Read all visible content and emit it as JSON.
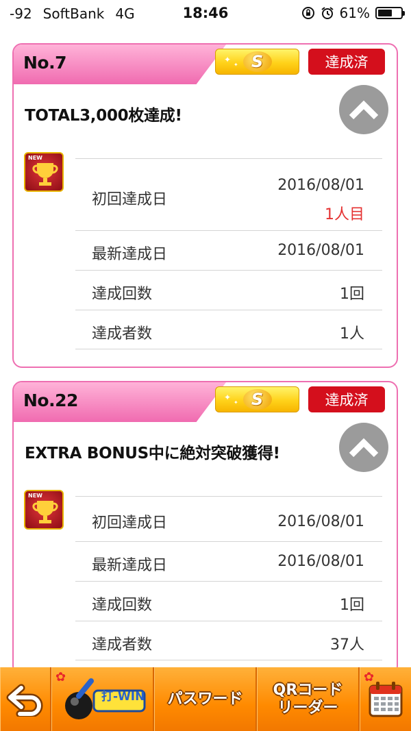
{
  "status_bar": {
    "signal": "-92",
    "carrier": "SoftBank",
    "network": "4G",
    "time": "18:46",
    "battery_percent": "61%",
    "battery_level": 0.61
  },
  "cards": [
    {
      "number": "No.7",
      "rank": "S",
      "status": "達成済",
      "title": "TOTAL3,000枚達成!",
      "trophy_badge": "NEW",
      "rows": [
        {
          "label": "初回達成日",
          "value": "2016/08/01",
          "sub": "1人目"
        },
        {
          "label": "最新達成日",
          "value": "2016/08/01"
        },
        {
          "label": "達成回数",
          "value": "1回"
        },
        {
          "label": "達成者数",
          "value": "1人"
        }
      ]
    },
    {
      "number": "No.22",
      "rank": "S",
      "status": "達成済",
      "title": "EXTRA BONUS中に絶対突破獲得!",
      "trophy_badge": "NEW",
      "rows": [
        {
          "label": "初回達成日",
          "value": "2016/08/01"
        },
        {
          "label": "最新達成日",
          "value": "2016/08/01"
        },
        {
          "label": "達成回数",
          "value": "1回"
        },
        {
          "label": "達成者数",
          "value": "37人"
        }
      ]
    }
  ],
  "bottom_nav": {
    "back_icon": "back-arrow-icon",
    "logo_text": "打-WIN",
    "password_label": "パスワード",
    "qr_label_line1": "QRコード",
    "qr_label_line2": "リーダー",
    "calendar_icon": "calendar-icon"
  },
  "colors": {
    "card_border": "#ee6fb1",
    "status_red": "#d40f1c",
    "nav_orange": "#ff8a00"
  }
}
